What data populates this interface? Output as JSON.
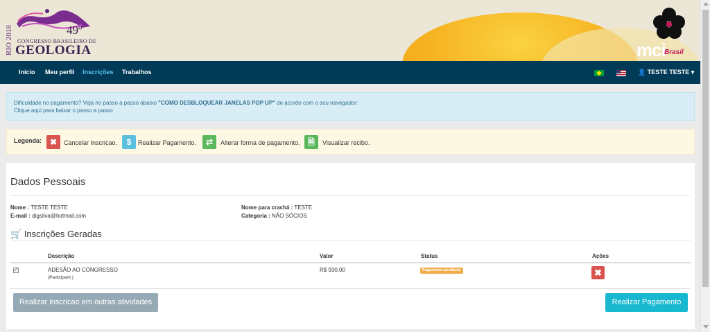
{
  "header": {
    "logo_side_text": "RIO 2018",
    "logo_edition": "49º",
    "logo_subtitle": "CONGRESSO BRASILEIRO DE",
    "logo_title": "GEOLOGIA",
    "partner_text": "mci",
    "partner_sub": "Brasil"
  },
  "nav": {
    "items": [
      {
        "label": "Início"
      },
      {
        "label": "Meu perfil"
      },
      {
        "label": "Inscrições"
      },
      {
        "label": "Trabalhos"
      }
    ],
    "active": "Inscrições",
    "user_label": "TESTE TESTE",
    "flags": [
      "brazil-flag-icon",
      "usa-flag-icon"
    ]
  },
  "alert_info": {
    "text_before": "Dificuldade no pagamento? Veja no passo a passo abaixo ",
    "text_bold": "\"COMO DESBLOQUEAR JANELAS POP UP\"",
    "text_after": " de acordo com o seu navegador:",
    "link": "Clique aqui para baixar o passo a passo"
  },
  "legend": {
    "title": "Legenda:",
    "items": [
      {
        "icon": "cancel-icon",
        "label": "Cancelar Inscricao."
      },
      {
        "icon": "dollar-icon",
        "label": "Realizar Pagamento."
      },
      {
        "icon": "exchange-icon",
        "label": "Alterar forma de pagamento."
      },
      {
        "icon": "document-icon",
        "label": "Visualizar recibo."
      }
    ]
  },
  "personal": {
    "title": "Dados Pessoais",
    "name_label": "Nome :",
    "name_value": "TESTE TESTE",
    "email_label": "E-mail :",
    "email_value": "digsilva@hotmail.com",
    "badge_name_label": "Nome para crachá :",
    "badge_name_value": "TESTE",
    "category_label": "Categoria :",
    "category_value": "NÃO SÓCIOS"
  },
  "registrations": {
    "title": "Inscrições Geradas",
    "columns": [
      "Descrição",
      "Valor",
      "Status",
      "Ações"
    ],
    "rows": [
      {
        "description": "ADESÃO AO CONGRESSO",
        "sub": "(Participant )",
        "value": "R$ 930,00",
        "status": "Pagamento pendente",
        "checked": true
      }
    ]
  },
  "actions": {
    "other_label": "Realizar inscricao em outras atividades",
    "pay_label": "Realizar Pagamento"
  },
  "colors": {
    "navbar": "#003a57",
    "accent": "#17b8d0",
    "danger": "#d9534f",
    "warning": "#f0ad4e",
    "info_bg": "#d9edf7",
    "legend_bg": "#fcf8e3"
  }
}
